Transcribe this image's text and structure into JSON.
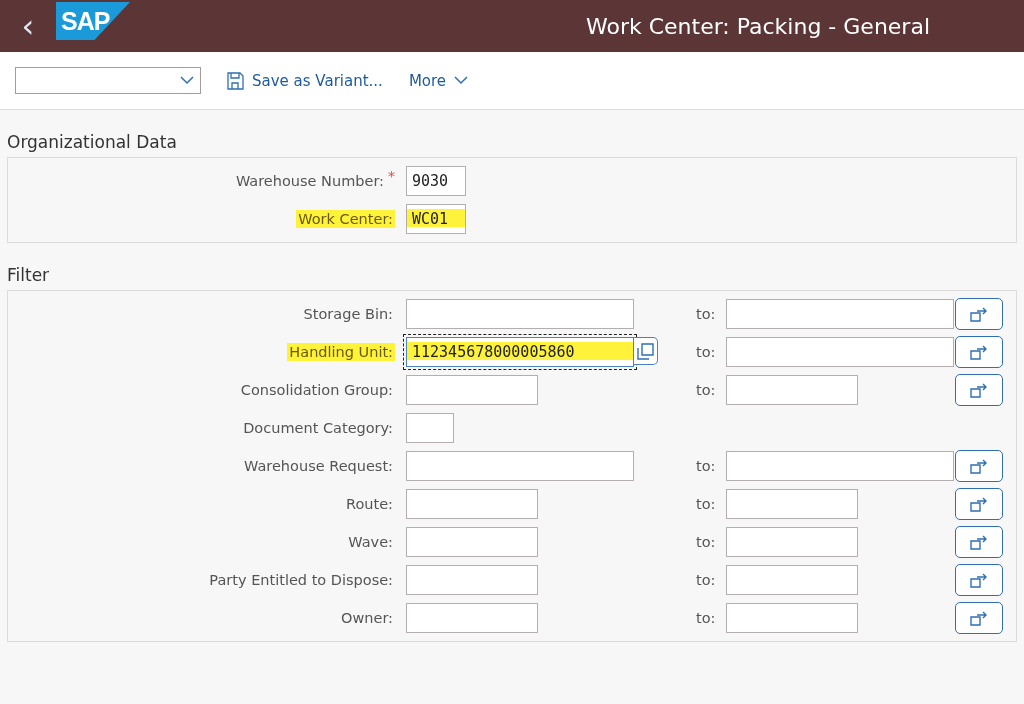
{
  "header": {
    "back": "‹",
    "logo": "SAP",
    "title": "Work Center: Packing - General"
  },
  "toolbar": {
    "save": "Save as Variant...",
    "more": "More"
  },
  "sections": [
    {
      "title": "Organizational Data",
      "rows": [
        {
          "label": "Warehouse Number:",
          "required_mark": "*",
          "kind": "code",
          "value": "9030",
          "highlighted": false,
          "focused": false
        },
        {
          "label": "Work Center:",
          "kind": "code",
          "value": "WC01",
          "highlighted": true,
          "focused": false
        }
      ]
    },
    {
      "title": "Filter",
      "rows": [
        {
          "label": "Storage Bin:",
          "kind": "wide",
          "value": "",
          "highlighted": false,
          "focused": false,
          "to": "to:"
        },
        {
          "label": "Handling Unit:",
          "kind": "wide",
          "value": "112345678000005860",
          "highlighted": true,
          "focused": true,
          "to": "to:"
        },
        {
          "label": "Consolidation Group:",
          "kind": "medium",
          "value": "",
          "highlighted": false,
          "focused": false,
          "to": "to:"
        },
        {
          "label": "Document Category:",
          "kind": "flag",
          "value": "",
          "highlighted": false,
          "focused": false
        },
        {
          "label": "Warehouse Request:",
          "kind": "wide",
          "value": "",
          "highlighted": false,
          "focused": false,
          "to": "to:"
        },
        {
          "label": "Route:",
          "kind": "medium",
          "value": "",
          "highlighted": false,
          "focused": false,
          "to": "to:"
        },
        {
          "label": "Wave:",
          "kind": "medium",
          "value": "",
          "highlighted": false,
          "focused": false,
          "to": "to:"
        },
        {
          "label": "Party Entitled to Dispose:",
          "kind": "medium",
          "value": "",
          "highlighted": false,
          "focused": false,
          "to": "to:"
        },
        {
          "label": "Owner:",
          "kind": "medium",
          "value": "",
          "highlighted": false,
          "focused": false,
          "to": "to:"
        }
      ]
    }
  ]
}
